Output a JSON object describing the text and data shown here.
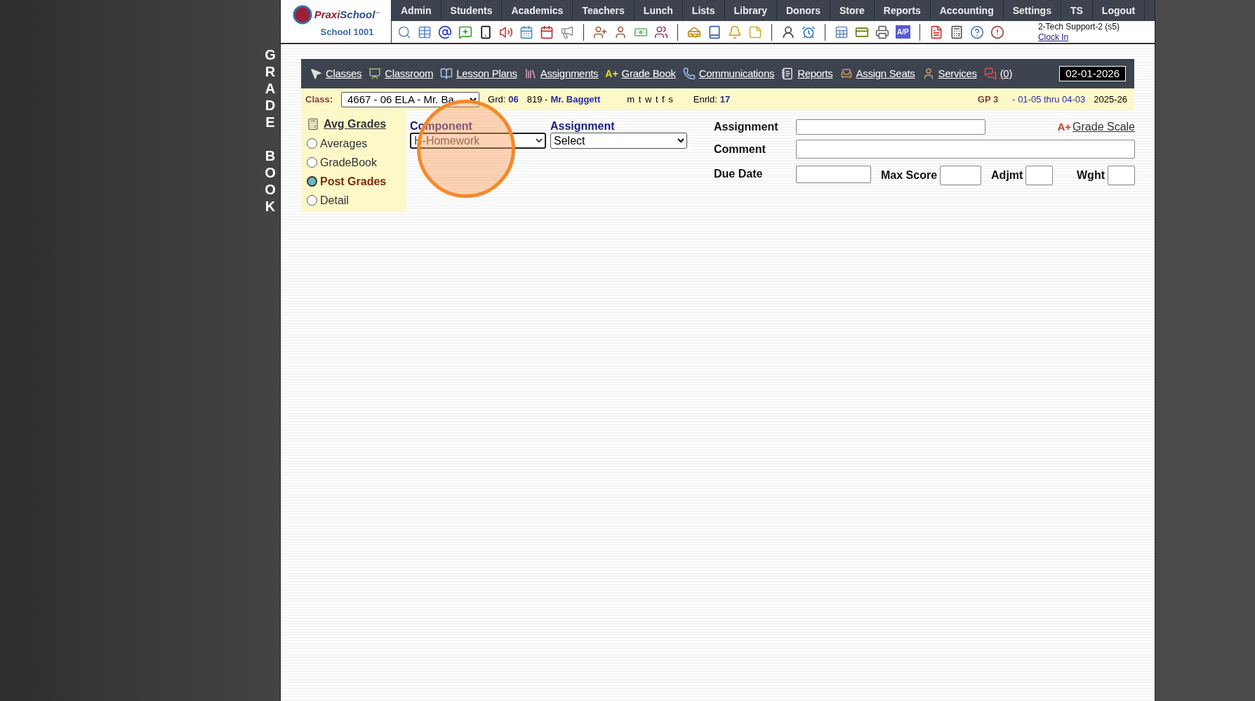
{
  "logo": {
    "brand_first": "Praxi",
    "brand_second": "School",
    "tm": "™",
    "school": "School 1001"
  },
  "nav": [
    "Admin",
    "Students",
    "Academics",
    "Teachers",
    "Lunch",
    "Lists",
    "Library",
    "Donors",
    "Store",
    "Reports",
    "Accounting",
    "Settings",
    "TS",
    "Logout"
  ],
  "toolbar_ap_label": "A/P",
  "user": {
    "name": "2-Tech Support-2 (s5)",
    "clock_link": "Clock In"
  },
  "side_title": "GRADE BOOK",
  "class_nav": [
    {
      "label": "Classes",
      "kind": "cursor"
    },
    {
      "label": "Classroom",
      "kind": "board"
    },
    {
      "label": "Lesson Plans",
      "kind": "book"
    },
    {
      "label": "Assignments",
      "kind": "books"
    },
    {
      "label": "Grade Book",
      "kind": "grade",
      "icon_text": "A+"
    },
    {
      "label": "Communications",
      "kind": "phone"
    },
    {
      "label": "Reports",
      "kind": "notepad"
    },
    {
      "label": "Assign Seats",
      "kind": "chair"
    },
    {
      "label": "Services",
      "kind": "person"
    },
    {
      "label": "(0)",
      "kind": "chat"
    }
  ],
  "date": "02-01-2026",
  "class_bar": {
    "label": "Class:",
    "class_value": "4667 - 06 ELA - Mr. Ba",
    "grd_label": "Grd:",
    "grade": "06",
    "room": "819 -",
    "teacher": "Mr. Baggett",
    "days": "m t w t f s",
    "enrld_label": "Enrld:",
    "enrolled": "17",
    "gp": "GP 3",
    "range": "- 01-05 thru 04-03",
    "year": "2025-26"
  },
  "avg_grades": "Avg Grades",
  "views": [
    {
      "label": "Averages",
      "selected": false
    },
    {
      "label": "GradeBook",
      "selected": false
    },
    {
      "label": "Post Grades",
      "selected": true
    },
    {
      "label": "Detail",
      "selected": false
    }
  ],
  "component": {
    "label": "Component",
    "value": "H-Homework"
  },
  "assignment_select": {
    "label": "Assignment",
    "value": "Select"
  },
  "form": {
    "assignment_label": "Assignment",
    "comment_label": "Comment",
    "due_label": "Due Date",
    "max_label": "Max Score",
    "adj_label": "Adjmt",
    "wght_label": "Wght",
    "grade_scale_icon": "A+",
    "grade_scale": "Grade Scale"
  }
}
